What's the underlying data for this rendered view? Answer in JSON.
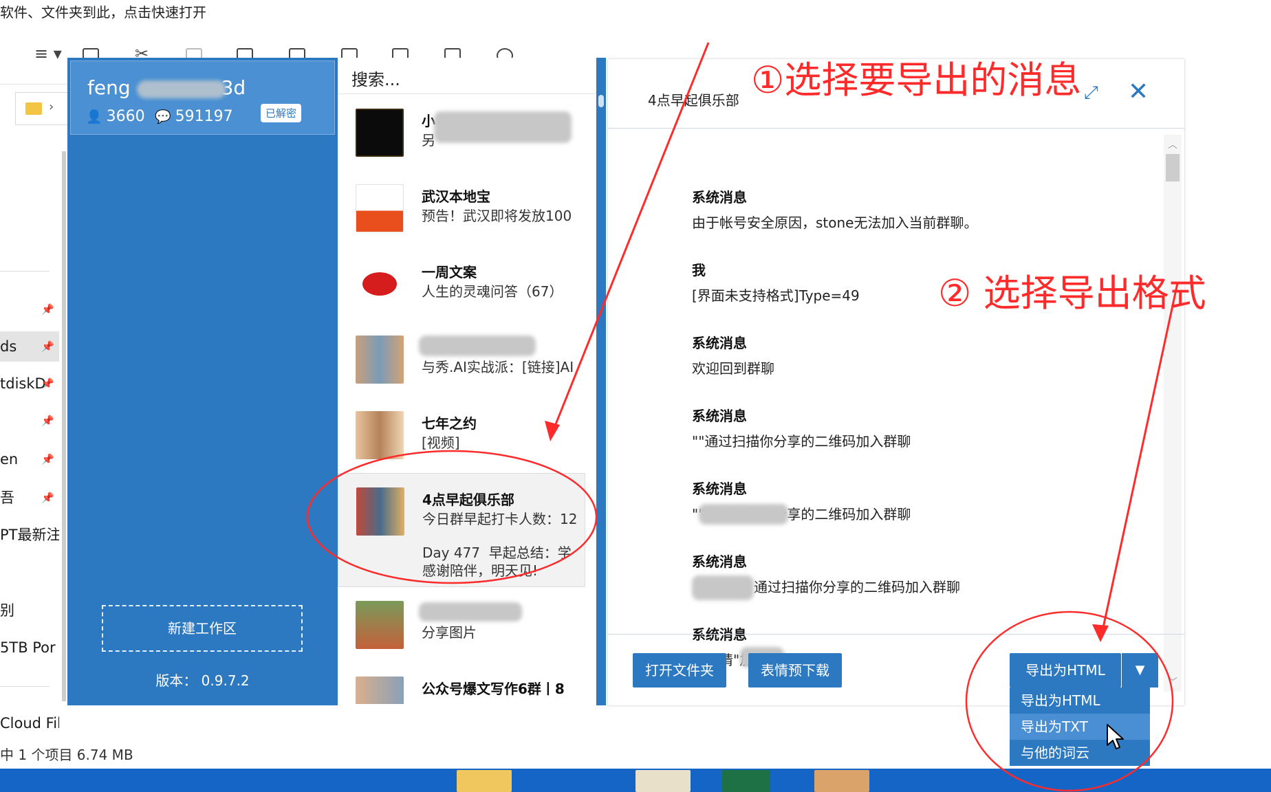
{
  "explorer": {
    "hint_text": "软件、文件夹到此，点击快速打开",
    "nav_items": [
      {
        "label": "ds",
        "pinned": true
      },
      {
        "label": "tdiskD",
        "pinned": true
      },
      {
        "label": "",
        "pinned": true
      },
      {
        "label": "en",
        "pinned": true
      },
      {
        "label": "吾",
        "pinned": true
      },
      {
        "label": "PT最新注",
        "pinned": false
      },
      {
        "label": "别",
        "pinned": false
      },
      {
        "label": "5TB Por",
        "pinned": false
      },
      {
        "label": "Cloud Fil",
        "pinned": false
      }
    ],
    "status_text": "中 1 个项目  6.74 MB"
  },
  "account": {
    "name_prefix": "feng",
    "name_suffix": "3d",
    "contacts": "3660",
    "messages": "591197",
    "badge": "已解密",
    "new_workspace": "新建工作区",
    "version": "版本： 0.9.7.2"
  },
  "chat_list": {
    "search_placeholder": "搜索...",
    "items": [
      {
        "title": "小",
        "preview": "另",
        "preview2": ""
      },
      {
        "title": "武汉本地宝",
        "preview": "预告！武汉即将发放100",
        "preview2": ""
      },
      {
        "title": "一周文案",
        "preview": "人生的灵魂问答（67）",
        "preview2": ""
      },
      {
        "title": "",
        "preview": "与秀.AI实战派：[链接]AI",
        "preview2": ""
      },
      {
        "title": "七年之约",
        "preview": "[视频]",
        "preview2": ""
      },
      {
        "title": "4点早起俱乐部",
        "preview": "今日群早起打卡人数：12",
        "preview2": "Day 477  早起总结：学\n感谢陪伴，明天见!"
      },
      {
        "title": "",
        "preview": "分享图片",
        "preview2": ""
      },
      {
        "title": "公众号爆文写作6群丨8",
        "preview": "",
        "preview2": ""
      }
    ]
  },
  "message_panel": {
    "group_title": "4点早起俱乐部",
    "messages": [
      {
        "sender": "系统消息",
        "text": "由于帐号安全原因，stone无法加入当前群聊。"
      },
      {
        "sender": "我",
        "text": "[界面未支持格式]Type=49"
      },
      {
        "sender": "系统消息",
        "text": "欢迎回到群聊"
      },
      {
        "sender": "系统消息",
        "text": "\"\"通过扫描你分享的二维码加入群聊"
      },
      {
        "sender": "系统消息",
        "text": "\"\"通过扫描你分享的二维码加入群聊"
      },
      {
        "sender": "系统消息",
        "text": "通过扫描你分享的二维码加入群聊"
      },
      {
        "sender": "系统消息",
        "text": "你邀请\"加入了群聊"
      }
    ],
    "open_folder": "打开文件夹",
    "emoji_download": "表情预下载",
    "export_button": "导出为HTML",
    "export_options": [
      "导出为HTML",
      "导出为TXT",
      "与他的词云"
    ]
  },
  "annotations": {
    "step1": "①选择要导出的消息",
    "step2": "② 选择导出格式"
  },
  "colors": {
    "accent": "#2d79c1",
    "annotation": "#ff2a2a"
  }
}
